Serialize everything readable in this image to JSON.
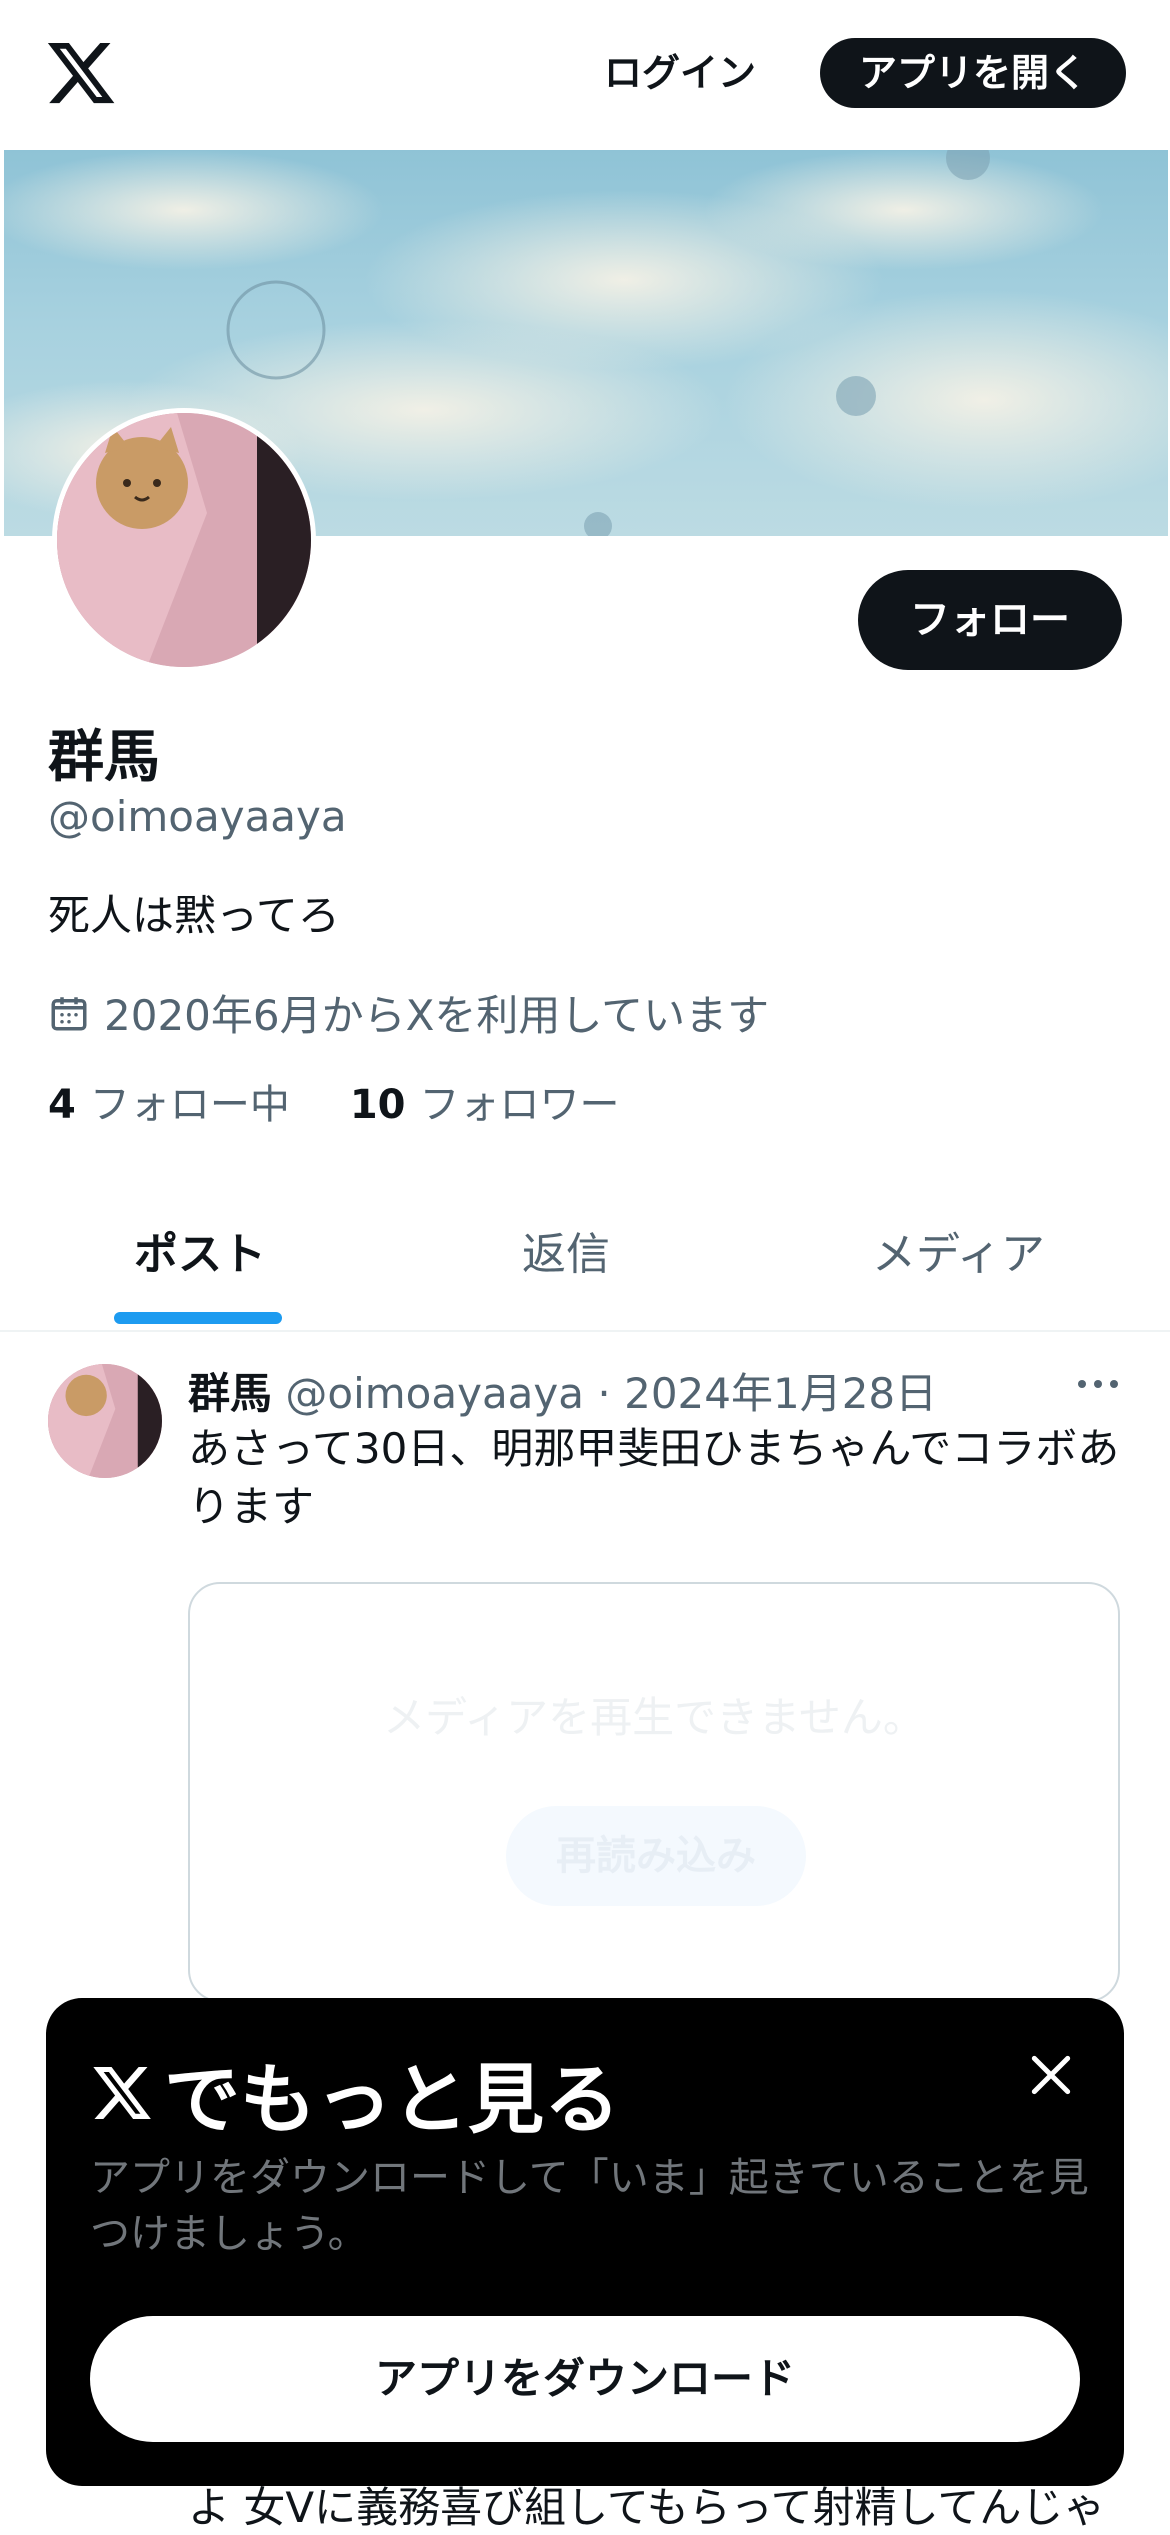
{
  "header": {
    "logo_icon": "x-logo-icon",
    "login_label": "ログイン",
    "open_app_label": "アプリを開く"
  },
  "profile": {
    "follow_label": "フォロー",
    "display_name": "群馬",
    "handle": "@oimoayaaya",
    "bio": "死人は黙ってろ",
    "joined": "2020年6月からXを利用しています",
    "following_count": "4",
    "following_label": "フォロー中",
    "followers_count": "10",
    "followers_label": "フォロワー"
  },
  "tabs": [
    {
      "label": "ポスト",
      "active": true
    },
    {
      "label": "返信",
      "active": false
    },
    {
      "label": "メディア",
      "active": false
    }
  ],
  "post": {
    "name": "群馬",
    "handle": "@oimoayaaya",
    "separator": "·",
    "date": "2024年1月28日",
    "text": "あさって30日、明那甲斐田ひまちゃんでコラボあります",
    "media_message": "メディアを再生できません。",
    "media_reload": "再読み込み"
  },
  "next_post_text": "よ 女Vに義務喜び組してもらって射精してんじゃ",
  "promo_sheet": {
    "title": "でもっと見る",
    "subtitle": "アプリをダウンロードして「いま」起きていることを見つけましょう。",
    "download_label": "アプリをダウンロード"
  },
  "colors": {
    "accent": "#1d9bf0",
    "text_primary": "#0f1419",
    "text_secondary": "#536471",
    "button_dark": "#0f1419"
  }
}
